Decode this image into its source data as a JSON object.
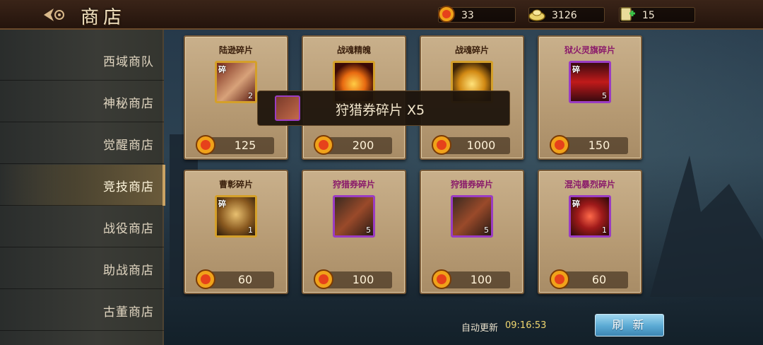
{
  "header": {
    "title": "商店",
    "resources": [
      {
        "icon": "gold-coin-icon",
        "value": "33"
      },
      {
        "icon": "silver-ingot-icon",
        "value": "3126"
      },
      {
        "icon": "stamina-scroll-icon",
        "value": "15"
      }
    ]
  },
  "sidebar": {
    "items": [
      {
        "label": "西域商队"
      },
      {
        "label": "神秘商店"
      },
      {
        "label": "觉醒商店"
      },
      {
        "label": "竞技商店",
        "active": true
      },
      {
        "label": "战役商店"
      },
      {
        "label": "助战商店"
      },
      {
        "label": "古董商店"
      }
    ]
  },
  "cards": [
    {
      "name": "陆逊碎片",
      "name_color": "dark",
      "frame": "gold",
      "tag": "碎",
      "count": "2",
      "price": "125"
    },
    {
      "name": "战魂精魄",
      "name_color": "dark",
      "frame": "gold",
      "tag": "",
      "count": "",
      "price": "200"
    },
    {
      "name": "战魂碎片",
      "name_color": "dark",
      "frame": "gold",
      "tag": "",
      "count": "",
      "price": "1000"
    },
    {
      "name": "狱火灵旗碎片",
      "name_color": "purple",
      "frame": "purple",
      "tag": "碎",
      "count": "5",
      "price": "150"
    },
    {
      "name": "曹彰碎片",
      "name_color": "dark",
      "frame": "gold",
      "tag": "碎",
      "count": "1",
      "price": "60"
    },
    {
      "name": "狩猎券碎片",
      "name_color": "purple",
      "frame": "purple",
      "tag": "",
      "count": "5",
      "price": "100"
    },
    {
      "name": "狩猎券碎片",
      "name_color": "purple",
      "frame": "purple",
      "tag": "",
      "count": "5",
      "price": "100"
    },
    {
      "name": "混沌暴烈碎片",
      "name_color": "purple",
      "frame": "purple",
      "tag": "碎",
      "count": "1",
      "price": "60"
    }
  ],
  "tooltip": {
    "text": "狩猎券碎片 X5"
  },
  "footer": {
    "auto_refresh_label": "自动更新",
    "auto_refresh_time": "09:16:53",
    "refresh_button": "刷 新"
  },
  "colors": {
    "accent_gold": "#c9a264",
    "refresh_blue": "#5aa9d3",
    "purple_text": "#8a1a6a"
  }
}
